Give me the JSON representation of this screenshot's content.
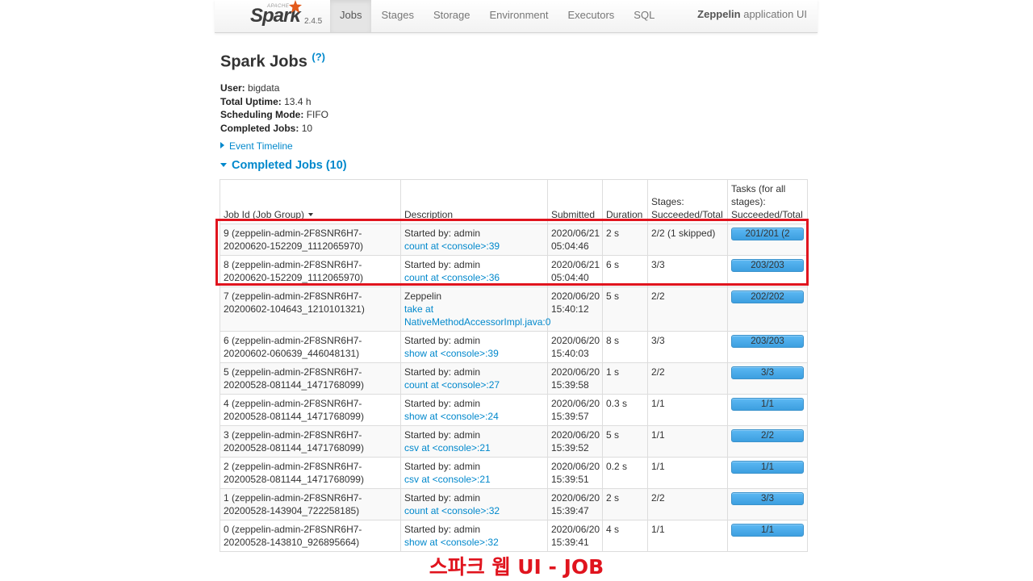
{
  "navbar": {
    "brand_apache": "APACHE",
    "brand_name": "Spark",
    "version": "2.4.5",
    "tabs": [
      {
        "label": "Jobs",
        "active": true
      },
      {
        "label": "Stages",
        "active": false
      },
      {
        "label": "Storage",
        "active": false
      },
      {
        "label": "Environment",
        "active": false
      },
      {
        "label": "Executors",
        "active": false
      },
      {
        "label": "SQL",
        "active": false
      }
    ],
    "app_name_bold": "Zeppelin",
    "app_name_rest": " application UI"
  },
  "page": {
    "title": "Spark Jobs",
    "help": "(?)",
    "summary": [
      {
        "label": "User:",
        "value": "bigdata",
        "link": false
      },
      {
        "label": "Total Uptime:",
        "value": "13.4 h",
        "link": false
      },
      {
        "label": "Scheduling Mode:",
        "value": "FIFO",
        "link": false
      },
      {
        "label": "Completed Jobs:",
        "value": "10",
        "link": true
      }
    ],
    "event_timeline": "Event Timeline",
    "completed_header": "Completed Jobs (10)"
  },
  "table": {
    "headers": {
      "job_id": "Job Id (Job Group)",
      "description": "Description",
      "submitted": "Submitted",
      "duration": "Duration",
      "stages": "Stages: Succeeded/Total",
      "tasks": "Tasks (for all stages): Succeeded/Total"
    },
    "rows": [
      {
        "job": "9 (zeppelin-admin-2F8SNR6H7-20200620-152209_1112065970)",
        "desc_line": "Started by: admin",
        "desc_link": "count at <console>:39",
        "submitted": "2020/06/21 05:04:46",
        "duration": "2 s",
        "stages": "2/2 (1 skipped)",
        "tasks": "201/201 (2",
        "progress": 1.0
      },
      {
        "job": "8 (zeppelin-admin-2F8SNR6H7-20200620-152209_1112065970)",
        "desc_line": "Started by: admin",
        "desc_link": "count at <console>:36",
        "submitted": "2020/06/21 05:04:40",
        "duration": "6 s",
        "stages": "3/3",
        "tasks": "203/203",
        "progress": 1.0
      },
      {
        "job": "7 (zeppelin-admin-2F8SNR6H7-20200602-104643_1210101321)",
        "desc_line": "Zeppelin",
        "desc_link": "take at NativeMethodAccessorImpl.java:0",
        "submitted": "2020/06/20 15:40:12",
        "duration": "5 s",
        "stages": "2/2",
        "tasks": "202/202",
        "progress": 1.0
      },
      {
        "job": "6 (zeppelin-admin-2F8SNR6H7-20200602-060639_446048131)",
        "desc_line": "Started by: admin",
        "desc_link": "show at <console>:39",
        "submitted": "2020/06/20 15:40:03",
        "duration": "8 s",
        "stages": "3/3",
        "tasks": "203/203",
        "progress": 1.0
      },
      {
        "job": "5 (zeppelin-admin-2F8SNR6H7-20200528-081144_1471768099)",
        "desc_line": "Started by: admin",
        "desc_link": "count at <console>:27",
        "submitted": "2020/06/20 15:39:58",
        "duration": "1 s",
        "stages": "2/2",
        "tasks": "3/3",
        "progress": 1.0
      },
      {
        "job": "4 (zeppelin-admin-2F8SNR6H7-20200528-081144_1471768099)",
        "desc_line": "Started by: admin",
        "desc_link": "show at <console>:24",
        "submitted": "2020/06/20 15:39:57",
        "duration": "0.3 s",
        "stages": "1/1",
        "tasks": "1/1",
        "progress": 1.0
      },
      {
        "job": "3 (zeppelin-admin-2F8SNR6H7-20200528-081144_1471768099)",
        "desc_line": "Started by: admin",
        "desc_link": "csv at <console>:21",
        "submitted": "2020/06/20 15:39:52",
        "duration": "5 s",
        "stages": "1/1",
        "tasks": "2/2",
        "progress": 1.0
      },
      {
        "job": "2 (zeppelin-admin-2F8SNR6H7-20200528-081144_1471768099)",
        "desc_line": "Started by: admin",
        "desc_link": "csv at <console>:21",
        "submitted": "2020/06/20 15:39:51",
        "duration": "0.2 s",
        "stages": "1/1",
        "tasks": "1/1",
        "progress": 1.0
      },
      {
        "job": "1 (zeppelin-admin-2F8SNR6H7-20200528-143904_722258185)",
        "desc_line": "Started by: admin",
        "desc_link": "count at <console>:32",
        "submitted": "2020/06/20 15:39:47",
        "duration": "2 s",
        "stages": "2/2",
        "tasks": "3/3",
        "progress": 1.0
      },
      {
        "job": "0 (zeppelin-admin-2F8SNR6H7-20200528-143810_926895664)",
        "desc_line": "Started by: admin",
        "desc_link": "show at <console>:32",
        "submitted": "2020/06/20 15:39:41",
        "duration": "4 s",
        "stages": "1/1",
        "tasks": "1/1",
        "progress": 1.0
      }
    ]
  },
  "caption": "스파크 웹 UI - JOB",
  "colors": {
    "link": "#0088cc",
    "progress": "#4aa9ea",
    "highlight": "#e0141e"
  }
}
